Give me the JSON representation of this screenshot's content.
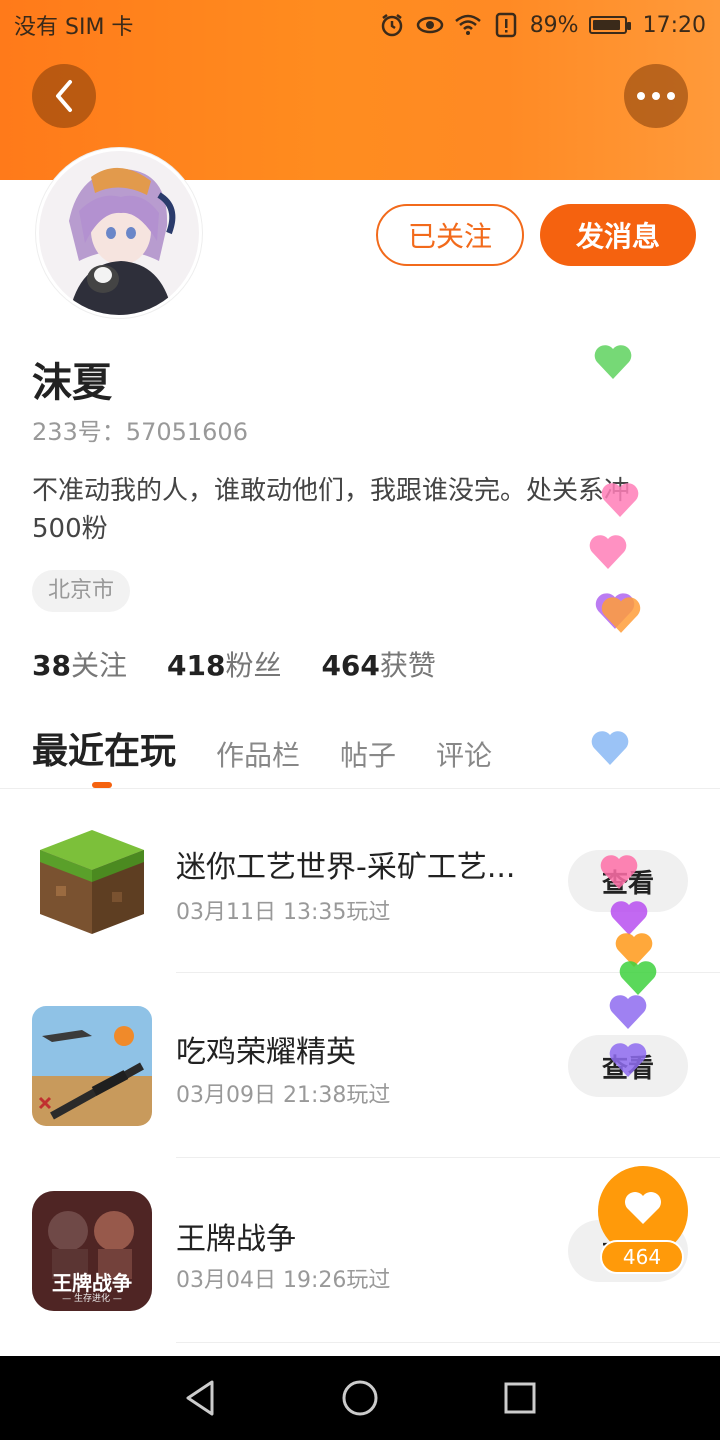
{
  "status_bar": {
    "carrier": "没有 SIM 卡",
    "battery": "89%",
    "battery_level": 0.89,
    "time": "17:20",
    "icons": [
      "alarm-icon",
      "eye-icon",
      "wifi-icon",
      "alert-icon",
      "battery-icon"
    ]
  },
  "header": {
    "back_icon": "chevron-left-icon",
    "more_icon": "more-icon"
  },
  "profile": {
    "follow_label": "已关注",
    "message_label": "发消息",
    "name": "沫夏",
    "id_text": "233号：57051606",
    "bio": "不准动我的人，谁敢动他们，我跟谁没完。处关系冲500粉",
    "location": "北京市",
    "stats": [
      {
        "num": "38",
        "label": "关注"
      },
      {
        "num": "418",
        "label": "粉丝"
      },
      {
        "num": "464",
        "label": "获赞"
      }
    ]
  },
  "tabs": [
    "最近在玩",
    "作品栏",
    "帖子",
    "评论"
  ],
  "games": [
    {
      "title": "迷你工艺世界-采矿工艺...",
      "time": "03月11日 13:35玩过",
      "button": "查看"
    },
    {
      "title": "吃鸡荣耀精英",
      "time": "03月09日 21:38玩过",
      "button": "查看"
    },
    {
      "title": "王牌战争",
      "time": "03月04日 19:26玩过",
      "button": "查看",
      "icon_text": "王牌战争",
      "icon_subtext": "— 生存进化 —"
    }
  ],
  "like_fab": {
    "count": "464",
    "icon": "heart-icon"
  },
  "floating_hearts": {
    "colors": [
      "#5fd35f",
      "#ff7eb8",
      "#ff7eb8",
      "#b066f0",
      "#ff9e3a",
      "#8ab9f5",
      "#ff6fa8",
      "#b84ff0",
      "#ff9a1a",
      "#3fd23f",
      "#8f6cf0",
      "#8f6cf0"
    ]
  },
  "colors": {
    "accent": "#f5620f",
    "header_orange": "#ff7a1a",
    "fab": "#ff9a0a"
  },
  "nav": [
    "back-triangle-icon",
    "home-circle-icon",
    "recents-square-icon"
  ]
}
